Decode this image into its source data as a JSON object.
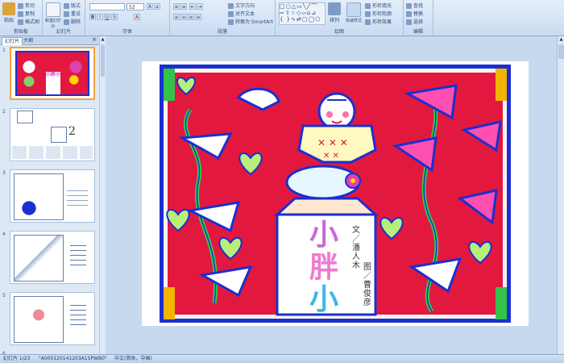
{
  "ribbon": {
    "clipboard": {
      "paste": "粘贴",
      "cut": "剪切",
      "copy": "复制",
      "format_painter": "格式刷",
      "label": "剪贴板"
    },
    "slides": {
      "new_slide": "新建幻灯片",
      "layout": "版式",
      "reset": "重设",
      "delete": "删除",
      "label": "幻灯片"
    },
    "font": {
      "size": "52",
      "label": "字体"
    },
    "paragraph": {
      "text_direction": "文字方向",
      "align_text": "对齐文本",
      "convert_smartart": "转换为 SmartArt",
      "label": "段落"
    },
    "drawing": {
      "arrange": "排列",
      "quick_styles": "快速样式",
      "shape_fill": "形状填充",
      "shape_outline": "形状轮廓",
      "shape_effects": "形状效果",
      "label": "绘图"
    },
    "editing": {
      "find": "查找",
      "replace": "替换",
      "select": "选择",
      "label": "编辑"
    }
  },
  "pane": {
    "tab_slides": "幻灯片",
    "tab_outline": "大纲",
    "thumbs": [
      {
        "num": "1"
      },
      {
        "num": "2"
      },
      {
        "num": "3"
      },
      {
        "num": "4"
      },
      {
        "num": "5"
      }
    ],
    "thumb1_title": "小胖小",
    "thumb2_number": "2"
  },
  "slide": {
    "title_chars": [
      "小",
      "胖",
      "小"
    ],
    "author_line1": "文／潘人木",
    "author_line2": "图／曹俊彦"
  },
  "status": {
    "slide_count": "幻灯片 1/23",
    "theme": "\"A0001201412​03A15PWB0\"",
    "language": "中文(简体，中国)"
  },
  "colors": {
    "accent": "#f3a43c",
    "slide_red": "#e2183f",
    "slide_blue": "#1b2fd0"
  }
}
